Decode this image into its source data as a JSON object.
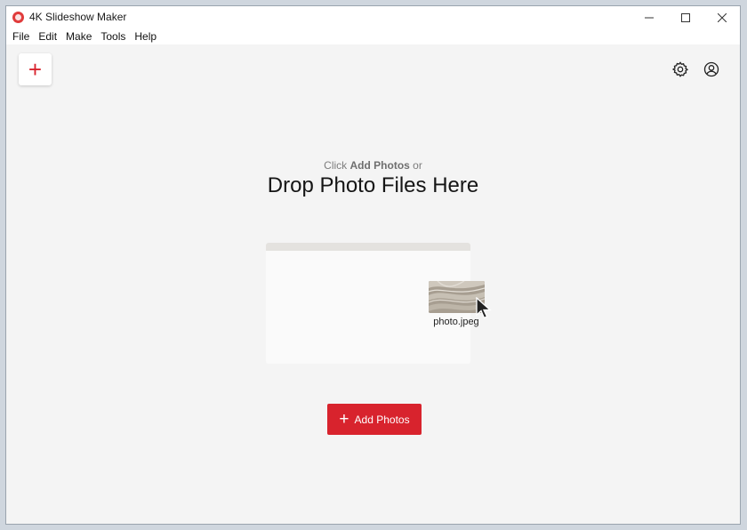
{
  "window": {
    "title": "4K Slideshow Maker",
    "controls": {
      "minimize": "—",
      "maximize": "☐",
      "close": "✕"
    }
  },
  "menu": [
    "File",
    "Edit",
    "Make",
    "Tools",
    "Help"
  ],
  "toolbar": {
    "new_icon": "plus-icon",
    "new_glyph": "+",
    "settings_icon": "gear-icon",
    "account_icon": "account-icon"
  },
  "main": {
    "hint_prefix": "Click ",
    "hint_bold": "Add Photos",
    "hint_suffix": " or",
    "headline": "Drop Photo Files Here",
    "file_label": "photo.jpeg",
    "add_button_glyph": "+",
    "add_button_label": "Add Photos"
  },
  "colors": {
    "accent": "#d8232d",
    "background": "#f4f4f4",
    "white": "#ffffff"
  }
}
